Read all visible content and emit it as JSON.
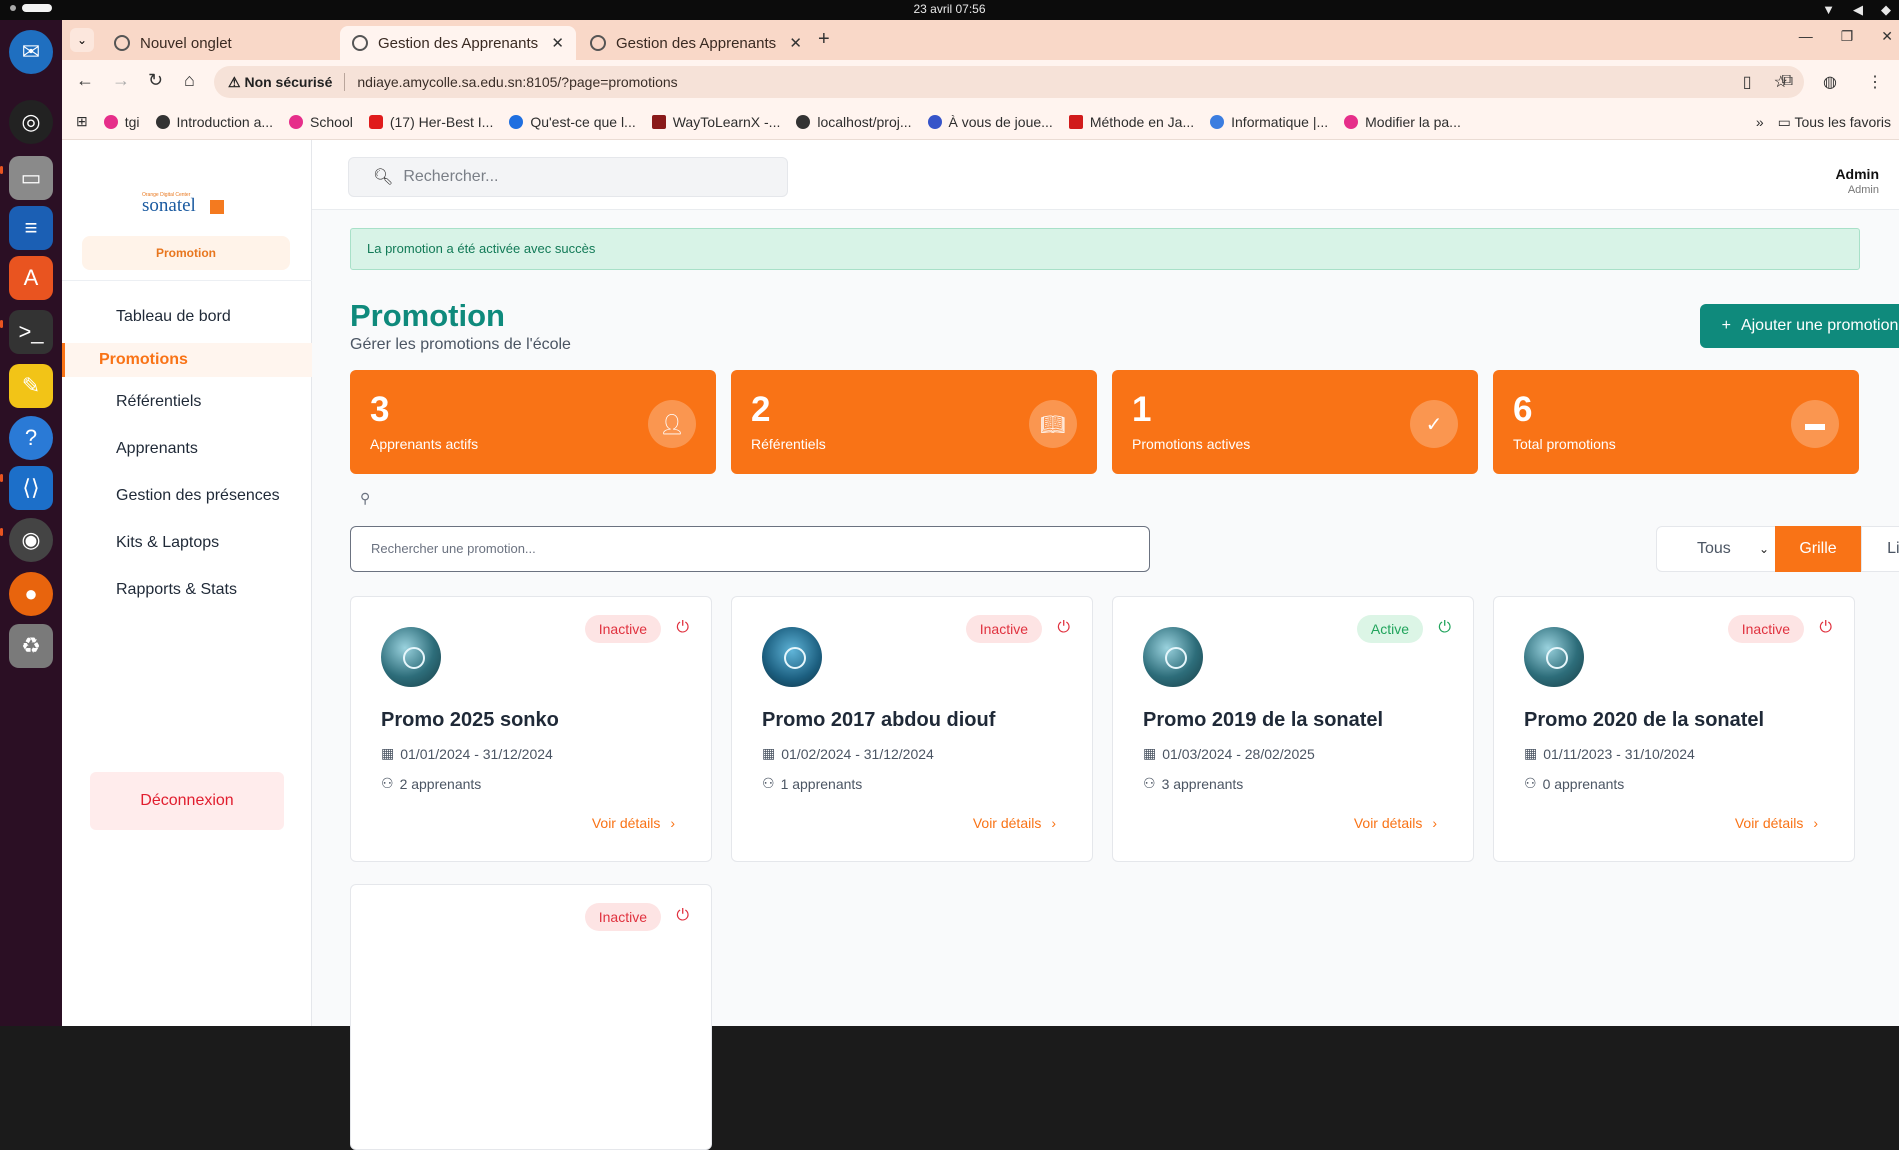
{
  "os": {
    "clock": "23 avril  07:56"
  },
  "browser": {
    "tabs": [
      {
        "label": "Nouvel onglet"
      },
      {
        "label": "Gestion des Apprenants"
      },
      {
        "label": "Gestion des Apprenants"
      }
    ],
    "security": "Non sécurisé",
    "url": "ndiaye.amycolle.sa.edu.sn:8105/?page=promotions",
    "bookmarks": [
      {
        "label": "tgi",
        "color": "#e62e8a"
      },
      {
        "label": "Introduction a...",
        "color": "#333333"
      },
      {
        "label": "School",
        "color": "#e62e8a"
      },
      {
        "label": "(17) Her-Best I...",
        "color": "#e01b1b"
      },
      {
        "label": "Qu'est-ce que l...",
        "color": "#1f6fe0"
      },
      {
        "label": "WayToLearnX -...",
        "color": "#8a1a1a"
      },
      {
        "label": "localhost/proj...",
        "color": "#333333"
      },
      {
        "label": "À vous de joue...",
        "color": "#3654c9"
      },
      {
        "label": "Méthode en Ja...",
        "color": "#d11b1b"
      },
      {
        "label": "Informatique |...",
        "color": "#3b7de0"
      },
      {
        "label": "Modifier la pa...",
        "color": "#e62e8a"
      }
    ],
    "all_bookmarks": "Tous les favoris"
  },
  "sidebar": {
    "logo_small": "Orange Digital Center",
    "logo_name": "sonatel",
    "badge": "Promotion",
    "items": [
      {
        "label": "Tableau de bord"
      },
      {
        "label": "Promotions"
      },
      {
        "label": "Référentiels"
      },
      {
        "label": "Apprenants"
      },
      {
        "label": "Gestion des présences"
      },
      {
        "label": "Kits & Laptops"
      },
      {
        "label": "Rapports & Stats"
      }
    ],
    "logout": "Déconnexion"
  },
  "header": {
    "search_placeholder": "Rechercher...",
    "user_name": "Admin",
    "user_role": "Admin"
  },
  "main": {
    "alert": "La promotion a été activée avec succès",
    "title": "Promotion",
    "subtitle": "Gérer les promotions de l'école",
    "add_button": "Ajouter une promotion",
    "stats": [
      {
        "value": "3",
        "label": "Apprenants actifs",
        "icon": "user-icon"
      },
      {
        "value": "2",
        "label": "Référentiels",
        "icon": "book-icon"
      },
      {
        "value": "1",
        "label": "Promotions actives",
        "icon": "check-icon"
      },
      {
        "value": "6",
        "label": "Total promotions",
        "icon": "folder-icon"
      }
    ],
    "filter_placeholder": "Rechercher une promotion...",
    "filter_select": "Tous",
    "view_grid": "Grille",
    "view_list": "Liste",
    "cards": [
      {
        "status": "Inactive",
        "title": "Promo 2025 sonko",
        "dates": "01/01/2024 - 31/12/2024",
        "count": "2 apprenants",
        "details": "Voir détails"
      },
      {
        "status": "Inactive",
        "title": "Promo 2017 abdou diouf",
        "dates": "01/02/2024 - 31/12/2024",
        "count": "1 apprenants",
        "details": "Voir détails"
      },
      {
        "status": "Active",
        "title": "Promo 2019 de la sonatel",
        "dates": "01/03/2024 - 28/02/2025",
        "count": "3 apprenants",
        "details": "Voir détails"
      },
      {
        "status": "Inactive",
        "title": "Promo 2020 de la sonatel",
        "dates": "01/11/2023 - 31/10/2024",
        "count": "0 apprenants",
        "details": "Voir détails"
      },
      {
        "status": "Inactive",
        "title": "",
        "dates": "",
        "count": "",
        "details": ""
      }
    ]
  }
}
